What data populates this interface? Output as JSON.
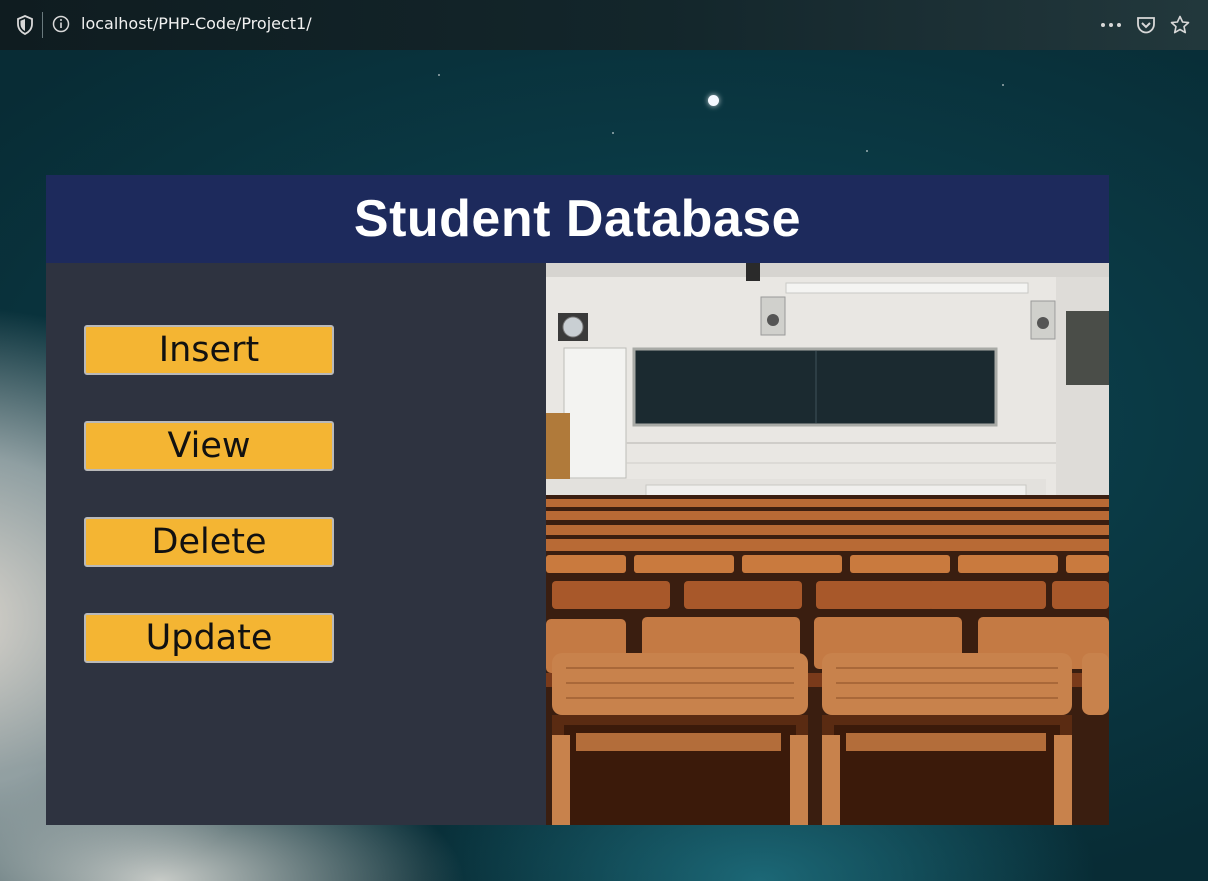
{
  "browser": {
    "url": "localhost/PHP-Code/Project1/",
    "icons": [
      "shield-icon",
      "info-icon",
      "more-icon",
      "pocket-icon",
      "star-icon"
    ]
  },
  "page": {
    "title": "Student Database",
    "buttons": {
      "insert": "Insert",
      "view": "View",
      "delete": "Delete",
      "update": "Update"
    }
  },
  "colors": {
    "header_bg": "#1d2a5c",
    "panel_bg": "#2e3340",
    "button_bg": "#f4b533"
  }
}
